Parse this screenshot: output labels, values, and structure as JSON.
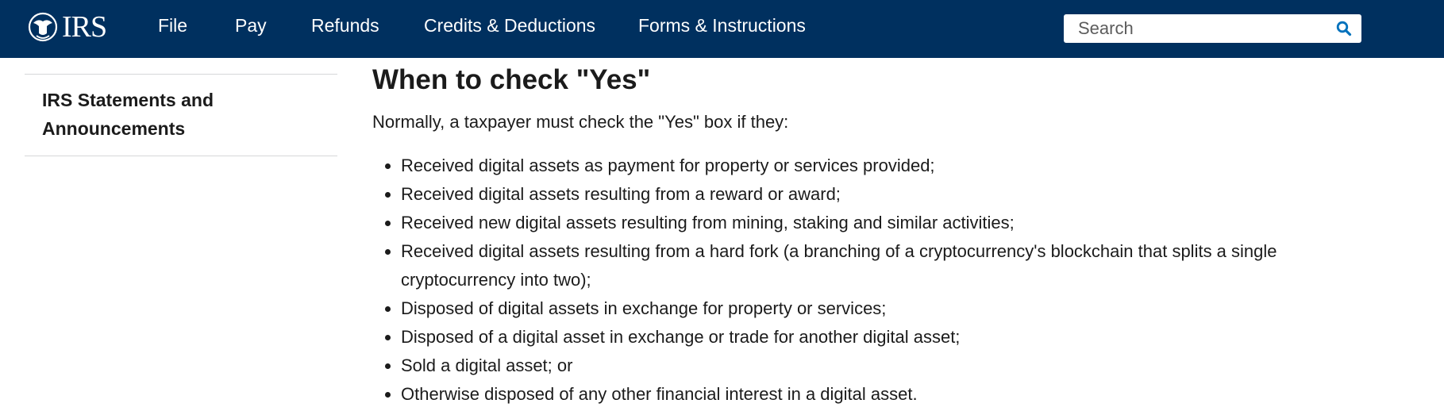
{
  "header": {
    "logo_text": "IRS",
    "background_color": "#00305f",
    "nav": [
      {
        "label": "File"
      },
      {
        "label": "Pay"
      },
      {
        "label": "Refunds"
      },
      {
        "label": "Credits & Deductions"
      },
      {
        "label": "Forms & Instructions"
      }
    ],
    "search": {
      "placeholder": "Search",
      "icon": "search-icon",
      "icon_color": "#0071bc"
    }
  },
  "sidebar": {
    "items": [
      {
        "label": "IRS Statements and Announcements"
      }
    ]
  },
  "main": {
    "heading": "When to check \"Yes\"",
    "intro": "Normally, a taxpayer must check the \"Yes\" box if they:",
    "bullets": [
      "Received digital assets as payment for property or services provided;",
      "Received digital assets resulting from a reward or award;",
      "Received new digital assets resulting from mining, staking and similar activities;",
      "Received digital assets resulting from a hard fork (a branching of a cryptocurrency's blockchain that splits a single cryptocurrency into two);",
      "Disposed of digital assets in exchange for property or services;",
      "Disposed of a digital asset in exchange or trade for another digital asset;",
      "Sold a digital asset; or",
      "Otherwise disposed of any other financial interest in a digital asset."
    ]
  }
}
